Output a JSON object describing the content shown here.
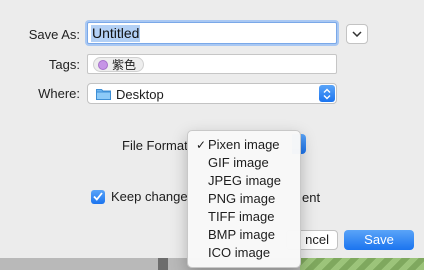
{
  "dialog": {
    "save_as_label": "Save As:",
    "filename": "Untitled",
    "tags_label": "Tags:",
    "tag": {
      "name": "紫色",
      "color": "#c695e6"
    },
    "where_label": "Where:",
    "where_value": "Desktop",
    "file_format_label": "File Format",
    "format_menu": {
      "selected": "Pixen image",
      "check": "✓",
      "items": [
        "Pixen image",
        "GIF image",
        "JPEG image",
        "PNG image",
        "TIFF image",
        "BMP image",
        "ICO image"
      ]
    },
    "keep_changes_label": "Keep change",
    "keep_changes_tail": "ent",
    "keep_changes_checked": true,
    "cancel_label": "ncel",
    "save_label": "Save"
  },
  "colors": {
    "accent": "#1b74ef",
    "selection": "#b3d0f5"
  },
  "icons": [
    "chevron-down-icon",
    "folder-icon",
    "popup-arrows-icon",
    "checkmark-icon"
  ]
}
